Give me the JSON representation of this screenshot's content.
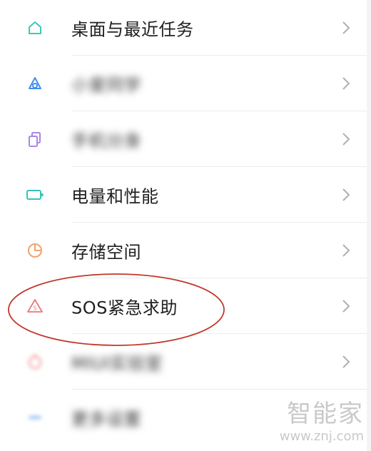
{
  "settings": {
    "items": [
      {
        "label": "桌面与最近任务",
        "icon": "home-icon",
        "blurred": false
      },
      {
        "label": "小爱同学",
        "icon": "assistant-icon",
        "blurred": true
      },
      {
        "label": "手机分身",
        "icon": "dual-phone-icon",
        "blurred": true
      },
      {
        "label": "电量和性能",
        "icon": "battery-icon",
        "blurred": false
      },
      {
        "label": "存储空间",
        "icon": "storage-pie-icon",
        "blurred": false
      },
      {
        "label": "SOS紧急求助",
        "icon": "sos-icon",
        "blurred": false
      },
      {
        "label": "MIUI实验室",
        "icon": "lab-icon",
        "blurred": true
      },
      {
        "label": "更多设置",
        "icon": "more-settings-icon",
        "blurred": true
      }
    ]
  },
  "colors": {
    "home_icon": "#3cc9b3",
    "assistant_icon": "#3f8ff0",
    "dual_icon": "#a987e6",
    "battery_icon": "#34c3b8",
    "storage_icon": "#f0a371",
    "sos_icon": "#e8787a",
    "highlight_ring": "#c0392b",
    "chevron": "#b0b0b0"
  },
  "watermark": {
    "cn": "智能家",
    "url": "www.znj.com"
  }
}
